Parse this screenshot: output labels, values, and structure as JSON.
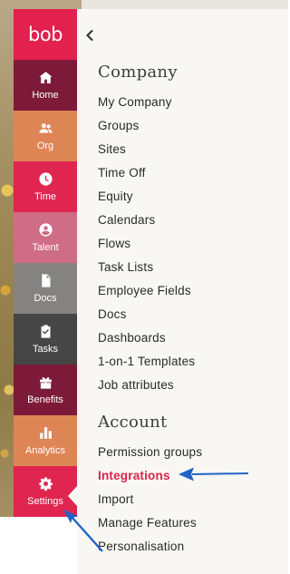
{
  "rail": {
    "logo_text": "bob",
    "items": [
      {
        "label": "Home",
        "icon": "home-icon",
        "color": "#7d1a3a"
      },
      {
        "label": "Org",
        "icon": "people-icon",
        "color": "#de8556"
      },
      {
        "label": "Time",
        "icon": "clock-icon",
        "color": "#df2550"
      },
      {
        "label": "Talent",
        "icon": "talent-icon",
        "color": "#cf6c86"
      },
      {
        "label": "Docs",
        "icon": "document-icon",
        "color": "#858382"
      },
      {
        "label": "Tasks",
        "icon": "clipboard-check-icon",
        "color": "#474646"
      },
      {
        "label": "Benefits",
        "icon": "gift-icon",
        "color": "#7d1a3a"
      },
      {
        "label": "Analytics",
        "icon": "bar-chart-icon",
        "color": "#de8556"
      },
      {
        "label": "Settings",
        "icon": "gear-icon",
        "color": "#df2550"
      }
    ]
  },
  "panel": {
    "collapse_icon": "chevron-left-icon",
    "company": {
      "title": "Company",
      "items": [
        "My Company",
        "Groups",
        "Sites",
        "Time Off",
        "Equity",
        "Calendars",
        "Flows",
        "Task Lists",
        "Employee Fields",
        "Docs",
        "Dashboards",
        "1-on-1 Templates",
        "Job attributes"
      ]
    },
    "account": {
      "title": "Account",
      "items": [
        "Permission groups",
        "Integrations",
        "Import",
        "Manage Features",
        "Personalisation"
      ],
      "active": "Integrations"
    }
  },
  "annotations": {
    "arrow_color": "#1f63c6",
    "arrows": [
      "arrow-to-integrations",
      "arrow-to-settings"
    ]
  }
}
